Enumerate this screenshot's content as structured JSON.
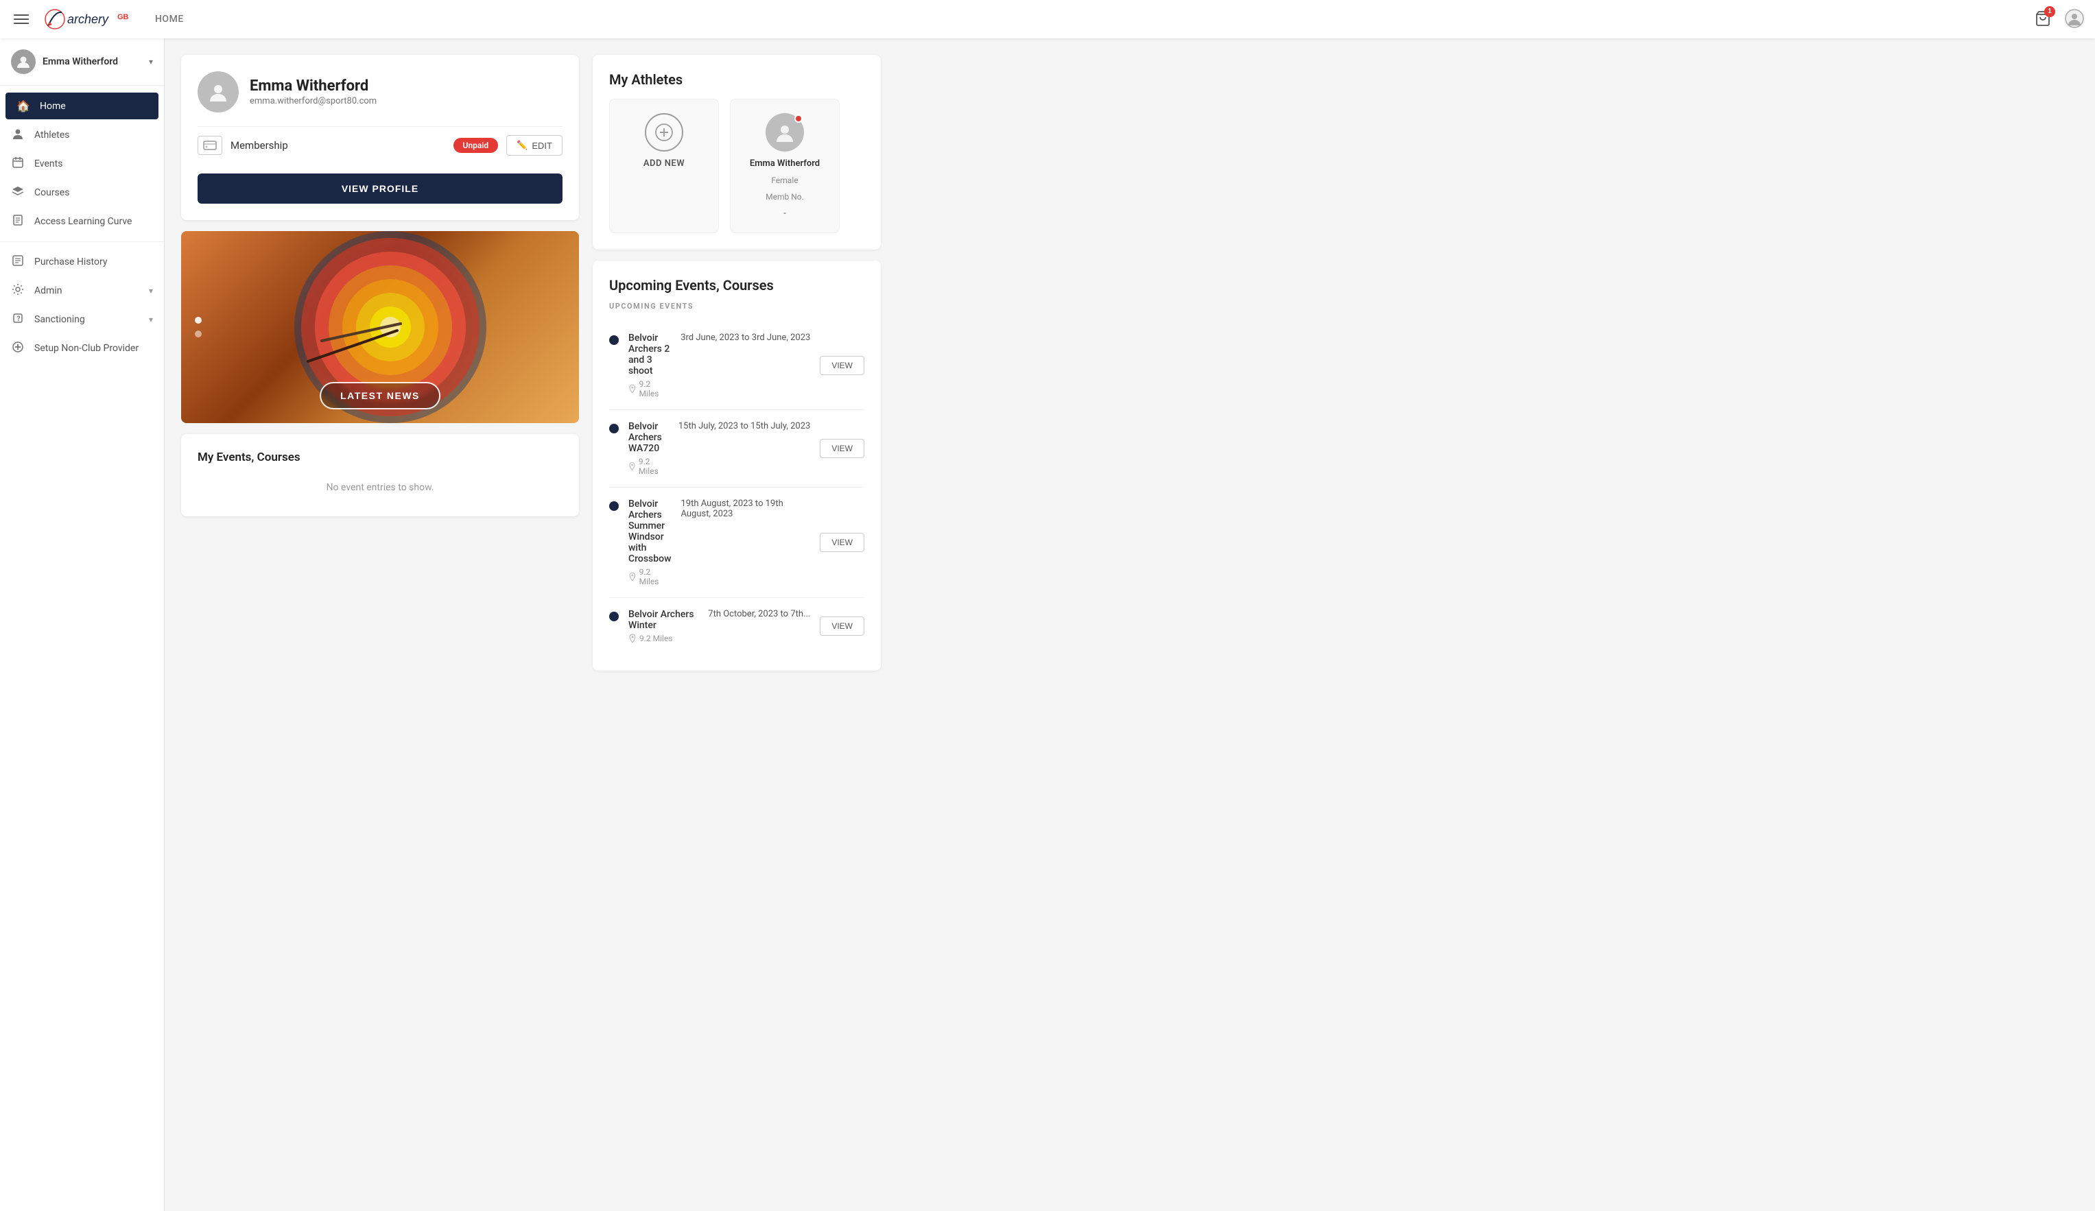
{
  "nav": {
    "home_label": "HOME",
    "cart_count": "1"
  },
  "sidebar": {
    "user": {
      "name": "Emma Witherford"
    },
    "items": [
      {
        "id": "home",
        "label": "Home",
        "icon": "🏠",
        "active": true
      },
      {
        "id": "athletes",
        "label": "Athletes",
        "icon": "👤"
      },
      {
        "id": "events",
        "label": "Events",
        "icon": "📅"
      },
      {
        "id": "courses",
        "label": "Courses",
        "icon": "🎓"
      },
      {
        "id": "access-learning-curve",
        "label": "Access Learning Curve",
        "icon": "📖"
      }
    ],
    "secondary_items": [
      {
        "id": "purchase-history",
        "label": "Purchase History",
        "icon": "🧾"
      },
      {
        "id": "admin",
        "label": "Admin",
        "icon": "⚙️",
        "has_chevron": true
      },
      {
        "id": "sanctioning",
        "label": "Sanctioning",
        "icon": "❓",
        "has_chevron": true
      },
      {
        "id": "setup-non-club",
        "label": "Setup Non-Club Provider",
        "icon": "➕"
      }
    ]
  },
  "profile": {
    "name": "Emma Witherford",
    "email": "emma.witherford@sport80.com",
    "membership_label": "Membership",
    "membership_status": "Unpaid",
    "edit_label": "EDIT",
    "view_profile_label": "VIEW PROFILE"
  },
  "hero": {
    "badge_label": "LATEST NEWS"
  },
  "my_events": {
    "title": "My Events, Courses",
    "empty_message": "No event entries to show."
  },
  "athletes": {
    "section_title": "My Athletes",
    "add_new_label": "ADD NEW",
    "athlete": {
      "name": "Emma Witherford",
      "gender": "Female",
      "memb_label": "Memb No.",
      "memb_value": "-"
    }
  },
  "upcoming": {
    "title": "Upcoming Events, Courses",
    "section_label": "UPCOMING EVENTS",
    "events": [
      {
        "name": "Belvoir Archers 2 and 3 shoot",
        "location": "9.2 Miles",
        "date": "3rd June, 2023 to 3rd June, 2023",
        "view_label": "VIEW"
      },
      {
        "name": "Belvoir Archers WA720",
        "location": "9.2 Miles",
        "date": "15th July, 2023 to 15th July, 2023",
        "view_label": "VIEW"
      },
      {
        "name": "Belvoir Archers Summer Windsor with Crossbow",
        "location": "9.2 Miles",
        "date": "19th August, 2023 to 19th August, 2023",
        "view_label": "VIEW"
      },
      {
        "name": "Belvoir Archers Winter",
        "location": "9.2 Miles",
        "date": "7th October, 2023 to 7th...",
        "view_label": "VIEW"
      }
    ]
  }
}
